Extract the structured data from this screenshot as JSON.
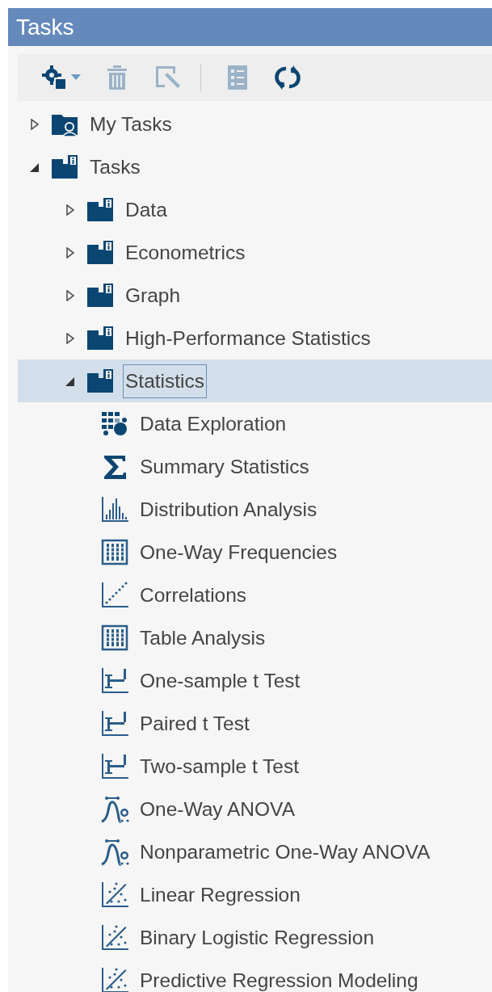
{
  "panel": {
    "title": "Tasks"
  },
  "toolbar": [
    {
      "kind": "new",
      "disabled": false
    },
    {
      "kind": "delete",
      "disabled": true
    },
    {
      "kind": "edit",
      "disabled": true
    },
    {
      "kind": "separator"
    },
    {
      "kind": "properties",
      "disabled": true
    },
    {
      "kind": "refresh",
      "disabled": false
    }
  ],
  "tree": [
    {
      "label": "My Tasks",
      "kind": "user-folder",
      "expanded": false,
      "selected": false
    },
    {
      "label": "Tasks",
      "kind": "folder",
      "expanded": true,
      "selected": false,
      "children": [
        {
          "label": "Data",
          "kind": "folder",
          "expanded": false,
          "selected": false
        },
        {
          "label": "Econometrics",
          "kind": "folder",
          "expanded": false,
          "selected": false
        },
        {
          "label": "Graph",
          "kind": "folder",
          "expanded": false,
          "selected": false
        },
        {
          "label": "High-Performance Statistics",
          "kind": "folder",
          "expanded": false,
          "selected": false
        },
        {
          "label": "Statistics",
          "kind": "folder",
          "expanded": true,
          "selected": true,
          "children": [
            {
              "label": "Data Exploration",
              "kind": "explore",
              "selected": false
            },
            {
              "label": "Summary Statistics",
              "kind": "sigma",
              "selected": false
            },
            {
              "label": "Distribution Analysis",
              "kind": "histogram",
              "selected": false
            },
            {
              "label": "One-Way Frequencies",
              "kind": "table",
              "selected": false
            },
            {
              "label": "Correlations",
              "kind": "correlation",
              "selected": false
            },
            {
              "label": "Table Analysis",
              "kind": "table",
              "selected": false
            },
            {
              "label": "One-sample t Test",
              "kind": "ttest",
              "selected": false
            },
            {
              "label": "Paired t Test",
              "kind": "ttest",
              "selected": false
            },
            {
              "label": "Two-sample t Test",
              "kind": "ttest",
              "selected": false
            },
            {
              "label": "One-Way ANOVA",
              "kind": "anova",
              "selected": false
            },
            {
              "label": "Nonparametric One-Way ANOVA",
              "kind": "anova",
              "selected": false
            },
            {
              "label": "Linear Regression",
              "kind": "regression",
              "selected": false
            },
            {
              "label": "Binary Logistic Regression",
              "kind": "regression",
              "selected": false
            },
            {
              "label": "Predictive Regression Modeling",
              "kind": "regression",
              "selected": false
            }
          ]
        }
      ]
    }
  ]
}
